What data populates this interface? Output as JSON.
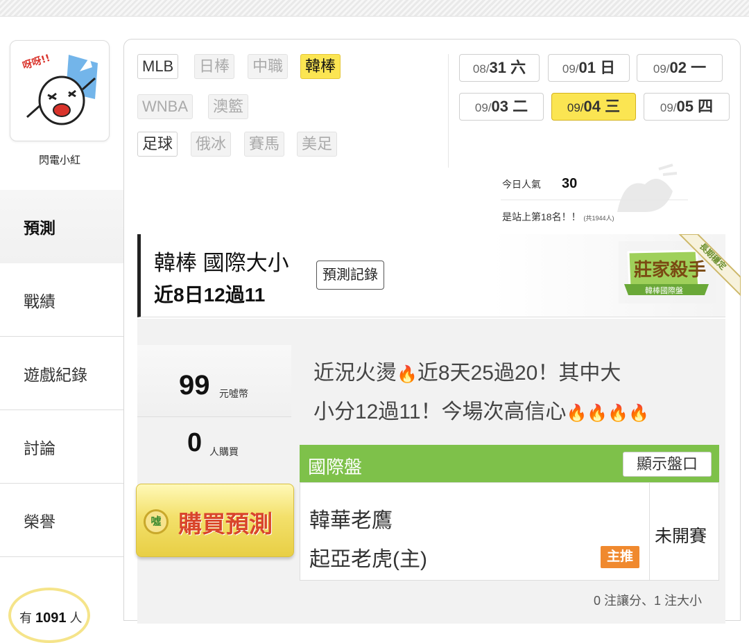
{
  "user": {
    "name": "閃電小紅",
    "avatar_text": "呀呀!!"
  },
  "sidebar": {
    "items": [
      {
        "label": "預測",
        "active": true
      },
      {
        "label": "戰績",
        "active": false
      },
      {
        "label": "遊戲紀錄",
        "active": false
      },
      {
        "label": "討論",
        "active": false
      },
      {
        "label": "榮譽",
        "active": false
      }
    ],
    "coin": {
      "prefix": "有",
      "value": "1091",
      "suffix": "人"
    }
  },
  "leagues": {
    "row1": [
      {
        "label": "MLB",
        "state": "normal"
      },
      {
        "label": "日棒",
        "state": "dim"
      },
      {
        "label": "中職",
        "state": "dim"
      },
      {
        "label": "韓棒",
        "state": "selected"
      }
    ],
    "row2": [
      {
        "label": "WNBA",
        "state": "dim"
      },
      {
        "label": "澳籃",
        "state": "dim"
      }
    ],
    "row3": [
      {
        "label": "足球",
        "state": "normal"
      },
      {
        "label": "俄冰",
        "state": "dim"
      },
      {
        "label": "賽馬",
        "state": "dim"
      },
      {
        "label": "美足",
        "state": "dim"
      }
    ]
  },
  "dates": [
    {
      "month": "08/",
      "day": "31 六",
      "selected": false
    },
    {
      "month": "09/",
      "day": "01 日",
      "selected": false
    },
    {
      "month": "09/",
      "day": "02 一",
      "selected": false
    },
    {
      "month": "09/",
      "day": "03 二",
      "selected": false
    },
    {
      "month": "09/",
      "day": "04 三",
      "selected": true
    },
    {
      "month": "09/",
      "day": "05 四",
      "selected": false
    }
  ],
  "popularity": {
    "label": "今日人氣",
    "value": "30",
    "rank_text": "是站上第18名！！",
    "rank_total": "(共1944人)"
  },
  "prediction": {
    "title": "韓棒 國際大小",
    "record": "近8日12過11",
    "history_button": "預測記錄",
    "badge_title": "莊家殺手",
    "badge_sub": "韓棒國際盤",
    "ribbon": "長期穩定",
    "price_value": "99",
    "price_unit": "元噓幣",
    "buyers_value": "0",
    "buyers_unit": "人購買",
    "buy_button": "購買預測",
    "buy_coin": "噓",
    "description_line1": "近況火燙",
    "description_line1b": "近8天25過20！其中大",
    "description_line2": "小分12過11！今場次高信心",
    "flame_icon": "🔥"
  },
  "market": {
    "title": "國際盤",
    "show_odds_button": "顯示盤口",
    "away_team": "韓華老鷹",
    "home_team": "起亞老虎(主)",
    "main_pick": "主推",
    "status": "未開賽",
    "bets_summary": "0 注讓分、1 注大小"
  },
  "colors": {
    "selected_yellow": "#fbe552",
    "market_green": "#7ec14a",
    "main_pick_orange": "#f0892e",
    "buy_text_red": "#d9452b"
  }
}
